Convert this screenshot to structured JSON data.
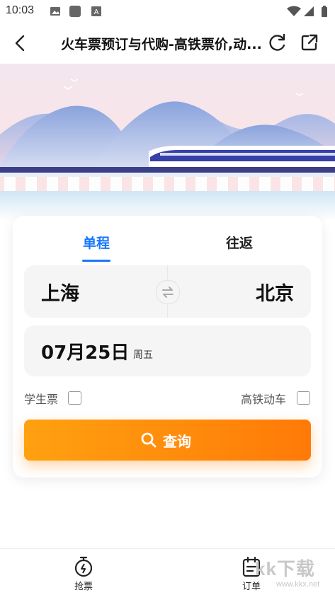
{
  "status_bar": {
    "time": "10:03"
  },
  "header": {
    "title": "火车票预订与代购-高铁票价,动..."
  },
  "tabs": [
    {
      "label": "单程",
      "active": true
    },
    {
      "label": "往返",
      "active": false
    }
  ],
  "route": {
    "from": "上海",
    "to": "北京"
  },
  "date": {
    "value": "07月25日",
    "weekday": "周五"
  },
  "options": {
    "student": "学生票",
    "high_speed": "高铁动车"
  },
  "search": {
    "label": "查询"
  },
  "bottom_nav": [
    {
      "label": "抢票",
      "icon": "stopwatch-icon"
    },
    {
      "label": "订单",
      "icon": "clipboard-icon"
    }
  ],
  "watermark": {
    "text": "kk下载",
    "url": "www.kkx.net"
  },
  "colors": {
    "accent": "#1677ff",
    "button_start": "#ffa110",
    "button_end": "#ff7a08"
  }
}
